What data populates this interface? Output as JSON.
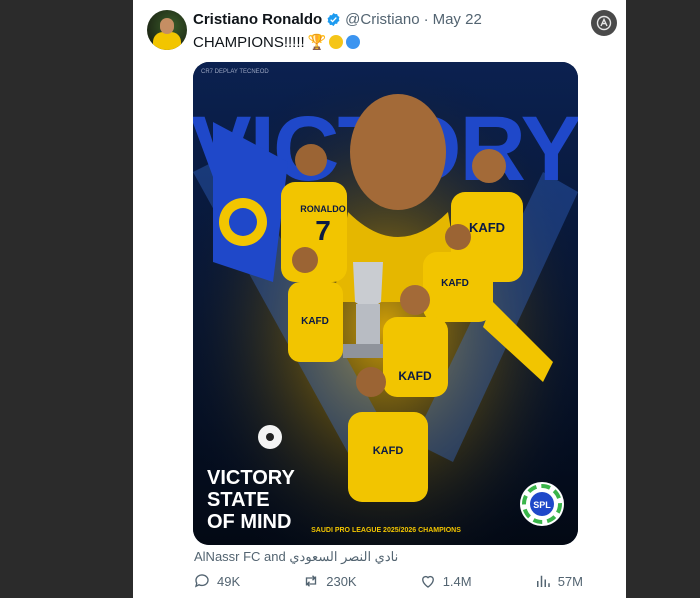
{
  "tweet": {
    "author_name": "Cristiano Ronaldo",
    "handle": "@Cristiano",
    "separator": "·",
    "date": "May 22",
    "text": "CHAMPIONS!!!!!",
    "trophy_emoji": "🏆"
  },
  "media": {
    "headline": "VICTORY",
    "tagline_line1": "VICTORY",
    "tagline_line2": "STATE",
    "tagline_line3": "OF MIND",
    "footer": "SAUDI PRO LEAGUE 2025/2026 CHAMPIONS",
    "top_marks": "CR7  DEPLAY  TECNEOD",
    "jersey_name": "RONALDO",
    "jersey_number": "7",
    "sponsor": "KAFD",
    "league_logo_text": "SPL"
  },
  "caption": "AlNassr FC and نادي النصر السعودي",
  "metrics": {
    "replies": "49K",
    "reposts": "230K",
    "likes": "1.4M",
    "views": "57M"
  },
  "colors": {
    "brand_yellow": "#f2c500",
    "brand_blue": "#1f48c9",
    "navy": "#06142f",
    "verified_blue": "#1d9bf0"
  }
}
